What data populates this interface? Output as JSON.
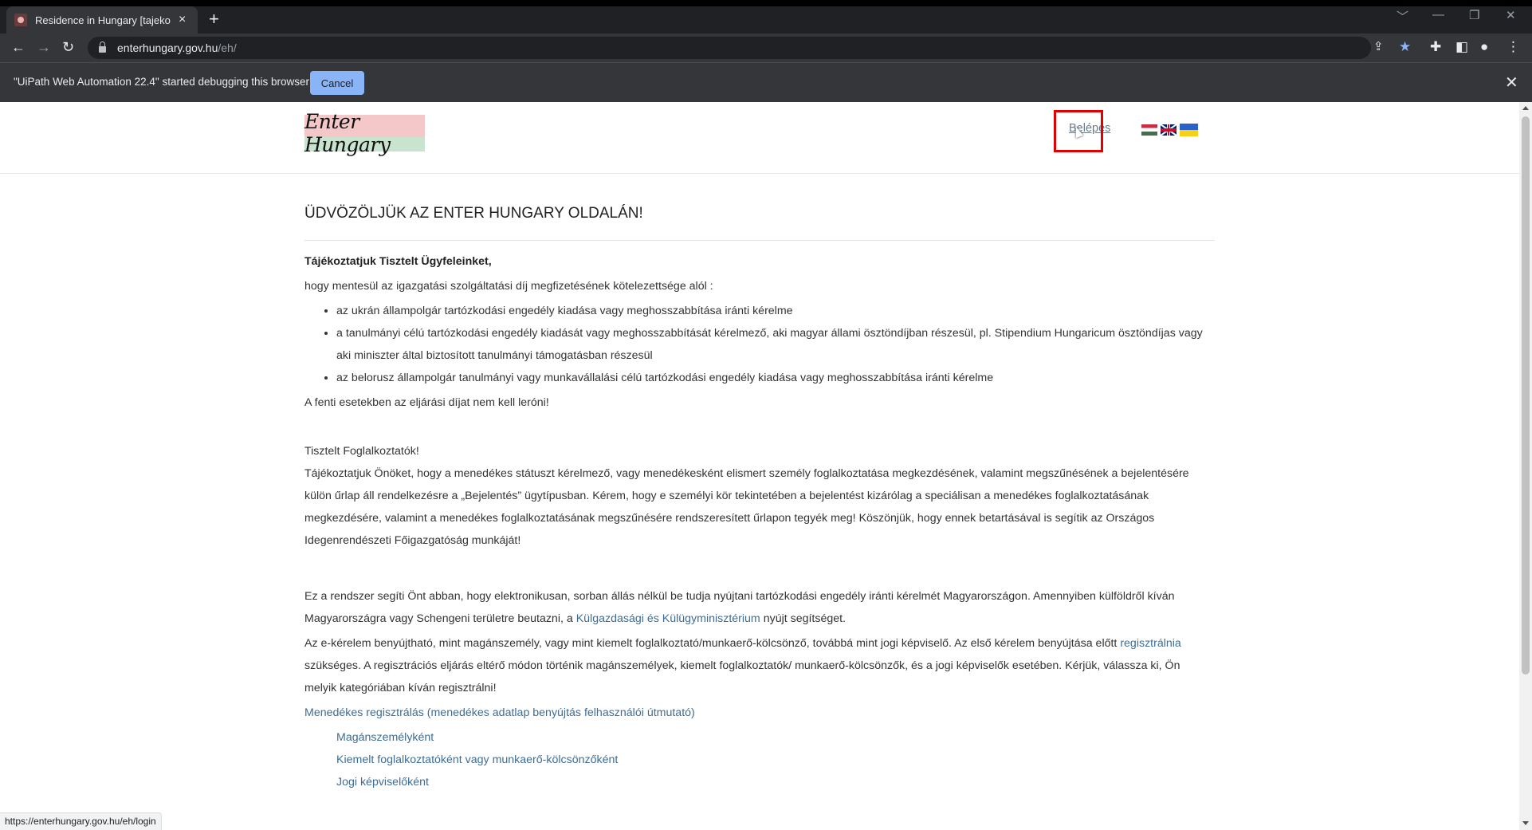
{
  "browser": {
    "tab_title": "Residence in Hungary [tajekoztat",
    "tab_close": "×",
    "new_tab": "+",
    "url_host": "enterhungary.gov.hu",
    "url_path": "/eh/",
    "window_controls": [
      "﹀",
      "—",
      "❐",
      "✕"
    ],
    "nav": {
      "back": "←",
      "forward": "→",
      "reload": "↻"
    }
  },
  "infobar": {
    "message": "\"UiPath Web Automation 22.4\" started debugging this browser",
    "cancel_label": "Cancel",
    "close": "✕"
  },
  "site": {
    "logo_text": "Enter Hungary",
    "login_label": "Belépés",
    "flags": [
      "hungarian-flag-icon",
      "uk-flag-icon",
      "ukraine-flag-icon"
    ]
  },
  "main": {
    "heading": "ÜDVÖZÖLJÜK AZ ENTER HUNGARY OLDALÁN!",
    "greeting": "Tájékoztatjuk Tisztelt Ügyfeleinket,",
    "intro": "hogy mentesül az igazgatási szolgáltatási díj megfizetésének kötelezettsége alól :",
    "exemptions": [
      "az ukrán állampolgár tartózkodási engedély kiadása vagy meghosszabbítása iránti kérelme",
      "a tanulmányi célú tartózkodási engedély kiadását vagy meghosszabbítását kérelmező, aki magyar állami ösztöndíjban részesül, pl. Stipendium Hungaricum ösztöndíjas vagy aki miniszter által biztosított tanulmányi támogatásban részesül",
      "az belorusz állampolgár tanulmányi vagy munkavállalási célú tartózkodási engedély kiadása vagy meghosszabbítása iránti kérelme"
    ],
    "fee_note": "A fenti esetekben az eljárási díjat nem kell leróni!",
    "employers_title": "Tisztelt Foglalkoztatók!",
    "employers_text": "Tájékoztatjuk Önöket, hogy a menedékes státuszt kérelmező, vagy menedékesként elismert személy foglalkoztatása megkezdésének, valamint megszűnésének a bejelentésére külön űrlap áll rendelkezésre a „Bejelentés” ügytípusban. Kérem, hogy e személyi kör tekintetében a bejelentést kizárólag a speciálisan a menedékes foglalkoztatásának megkezdésére, valamint a menedékes foglalkoztatásának megszűnésére rendszeresített űrlapon tegyék meg! Köszönjük, hogy ennek betartásával is segítik az Országos Idegenrendészeti Főigazgatóság munkáját!",
    "system_text_1": "Ez a rendszer segíti Önt abban, hogy elektronikusan, sorban állás nélkül be tudja nyújtani tartózkodási engedély iránti kérelmét Magyarországon. Amennyiben külföldről kíván Magyarországra vagy Schengeni területre beutazni, a ",
    "ministry_link": "Külgazdasági és Külügyminisztérium",
    "system_text_2": " nyújt segítséget.",
    "ekerelem_text_1": "Az e-kérelem benyújtható, mint magánszemély, vagy mint kiemelt foglalkoztató/munkaerő-kölcsönző, továbbá mint jogi képviselő. Az első kérelem benyújtása előtt ",
    "register_link": "regisztrálnia",
    "ekerelem_text_2": " szükséges. A regisztrációs eljárás eltérő módon történik magánszemélyek, kiemelt foglalkoztatók/ munkaerő-kölcsönzők, és a jogi képviselők esetében. Kérjük, válassza ki, Ön melyik kategóriában kíván regisztrálni!",
    "refugee_link": "Menedékes regisztrálás (menedékes adatlap benyújtás felhasználói útmutató)",
    "category_links": [
      "Magánszemélyként",
      "Kiemelt foglalkoztatóként vagy munkaerő-kölcsönzőként",
      "Jogi képviselőként"
    ]
  },
  "status_url": "https://enterhungary.gov.hu/eh/login"
}
